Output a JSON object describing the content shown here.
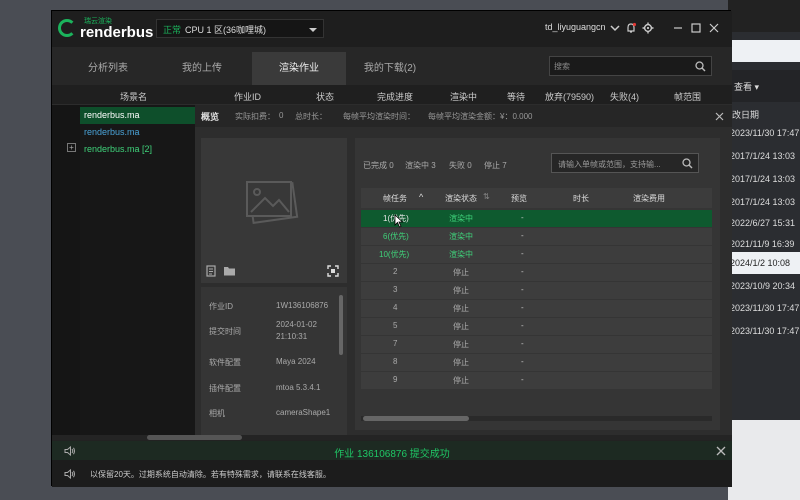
{
  "app": {
    "brand_small": "瑞云渲染",
    "brand": "renderbus",
    "zone_tag": "正常",
    "zone_name": "CPU 1 区(36咖哩城)",
    "username": "td_liyuguangcn"
  },
  "tabs": [
    {
      "label": "分析列表"
    },
    {
      "label": "我的上传"
    },
    {
      "label": "渲染作业"
    },
    {
      "label": "我的下载(2)"
    }
  ],
  "search": {
    "placeholder": "搜索"
  },
  "columns": [
    "场景名",
    "作业ID",
    "状态",
    "完成进度",
    "渲染中",
    "等待",
    "放弃(79590)",
    "失败(4)",
    "帧范围"
  ],
  "scenes": [
    {
      "name": "renderbus.ma"
    },
    {
      "name": "renderbus.ma"
    },
    {
      "name": "renderbus.ma [2]"
    }
  ],
  "overview": {
    "title": "概览",
    "actual_cost": "实际扣费：",
    "actual_cost_val": "0",
    "total_time": "总时长：",
    "avg_time": "每帧平均渲染时间：",
    "avg_cost": "每帧平均渲染金额：¥：0.000"
  },
  "job_info": [
    {
      "label": "作业ID",
      "value": "1W136106876"
    },
    {
      "label": "提交时间",
      "value": "2024-01-02"
    },
    {
      "label": "",
      "value": "21:10:31"
    },
    {
      "label": "软件配置",
      "value": "Maya 2024"
    },
    {
      "label": "插件配置",
      "value": "mtoa 5.3.4.1"
    },
    {
      "label": "相机",
      "value": "cameraShape1"
    }
  ],
  "frame_stats": {
    "done": "已完成 0",
    "rendering": "渲染中 3",
    "failed": "失败 0",
    "stopped": "停止 7"
  },
  "frame_search": {
    "placeholder": "请输入单帧或范围，支持输..."
  },
  "frame_columns": [
    "帧任务",
    "渲染状态",
    "预览",
    "时长",
    "渲染费用"
  ],
  "frames": [
    {
      "task": "1(优先)",
      "status": "渲染中",
      "preview": "-"
    },
    {
      "task": "6(优先)",
      "status": "渲染中",
      "preview": "-"
    },
    {
      "task": "10(优先)",
      "status": "渲染中",
      "preview": "-"
    },
    {
      "task": "2",
      "status": "停止",
      "preview": "-"
    },
    {
      "task": "3",
      "status": "停止",
      "preview": "-"
    },
    {
      "task": "4",
      "status": "停止",
      "preview": "-"
    },
    {
      "task": "5",
      "status": "停止",
      "preview": "-"
    },
    {
      "task": "7",
      "status": "停止",
      "preview": "-"
    },
    {
      "task": "8",
      "status": "停止",
      "preview": "-"
    },
    {
      "task": "9",
      "status": "停止",
      "preview": "-"
    }
  ],
  "notice": "作业 136106876 提交成功",
  "footer": "以保留20天。过期系统自动清除。若有特殊需求，请联系在线客服。",
  "bg_window": {
    "dropdown": "查看 ▾",
    "header": "改日期",
    "dates": [
      "2023/11/30 17:47",
      "2017/1/24 13:03",
      "2017/1/24 13:03",
      "2017/1/24 13:03",
      "2022/6/27 15:31",
      "2021/11/9 16:39",
      "2024/1/2 10:08",
      "2023/10/9 20:34",
      "2023/11/30 17:47",
      "2023/11/30 17:47"
    ]
  },
  "colors": {
    "accent": "#1bb35c",
    "selected_row": "#0e5a2f",
    "rendering_text": "#3fd27a"
  }
}
